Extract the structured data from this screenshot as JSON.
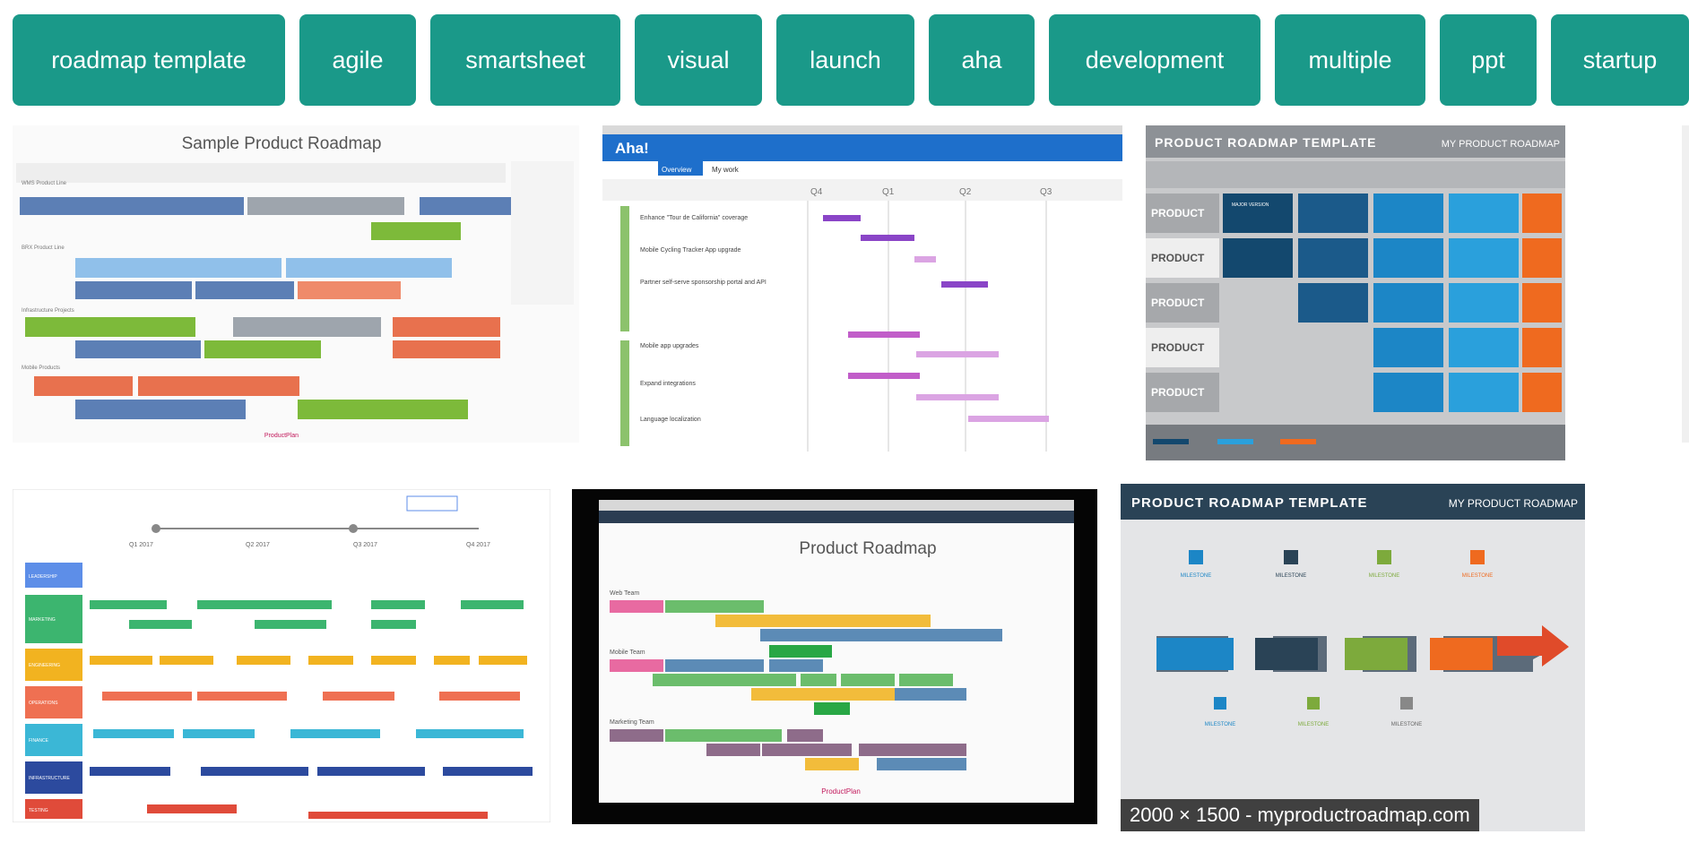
{
  "chips": [
    "roadmap template",
    "agile",
    "smartsheet",
    "visual",
    "launch",
    "aha",
    "development",
    "multiple",
    "ppt",
    "startup"
  ],
  "images": {
    "img1": {
      "title": "Sample Product Roadmap",
      "lanes": [
        "WMS Product Line",
        "BRX Product Line",
        "Infrastructure Projects",
        "Mobile Products"
      ],
      "footer": "ProductPlan"
    },
    "img2": {
      "logo": "Aha!",
      "tabs": [
        "Overview",
        "My work"
      ],
      "quarters": [
        "Q4",
        "Q1",
        "Q2",
        "Q3"
      ],
      "rows": [
        "Enhance \"Tour de California\" coverage",
        "Mobile Cycling Tracker App upgrade",
        "Partner self-serve sponsorship portal and API",
        "Mobile app upgrades",
        "Expand integrations",
        "Language localization"
      ]
    },
    "img3": {
      "title": "PRODUCT ROADMAP TEMPLATE",
      "brand": "MY PRODUCT ROADMAP",
      "row_label": "PRODUCT",
      "cell_label": "MAJOR VERSION",
      "colors": [
        "#13486e",
        "#1c86c6",
        "#2aa0dc",
        "#ef6a1f"
      ]
    },
    "img4": {
      "lanes": [
        "LEADERSHIP",
        "MARKETING",
        "ENGINEERING",
        "OPERATIONS",
        "FINANCE",
        "INFRASTRUCTURE",
        "TESTING"
      ],
      "lane_colors": [
        "#5d8ee8",
        "#3cb56f",
        "#f2b320",
        "#ef7052",
        "#3bb7d6",
        "#2c4a9e",
        "#e04b3a"
      ],
      "quarters": [
        "Q1 2017",
        "Q2 2017",
        "Q3 2017",
        "Q4 2017"
      ]
    },
    "img5": {
      "title": "Product Roadmap",
      "teams": [
        "Web Team",
        "Mobile Team",
        "Marketing Team"
      ],
      "footer": "ProductPlan"
    },
    "img6": {
      "title": "PRODUCT ROADMAP TEMPLATE",
      "brand": "MY PRODUCT ROADMAP",
      "milestone": "MILESTONE",
      "caption": "2000 × 1500 - myproductroadmap.com"
    }
  }
}
